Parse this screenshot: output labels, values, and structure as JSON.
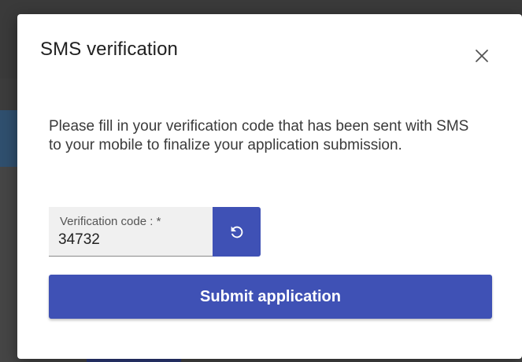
{
  "dialog": {
    "title": "SMS verification",
    "close_icon": "close-icon",
    "description": "Please fill in your verification code that has been sent with SMS to your mobile to finalize your application submission.",
    "verification_field": {
      "label": "Verification code : *",
      "value": "34732"
    },
    "refresh_icon": "refresh-icon",
    "submit_label": "Submit application"
  },
  "colors": {
    "primary": "#3f51b5",
    "field_background": "#f0f0f0",
    "overlay": "#3c3c3c"
  }
}
